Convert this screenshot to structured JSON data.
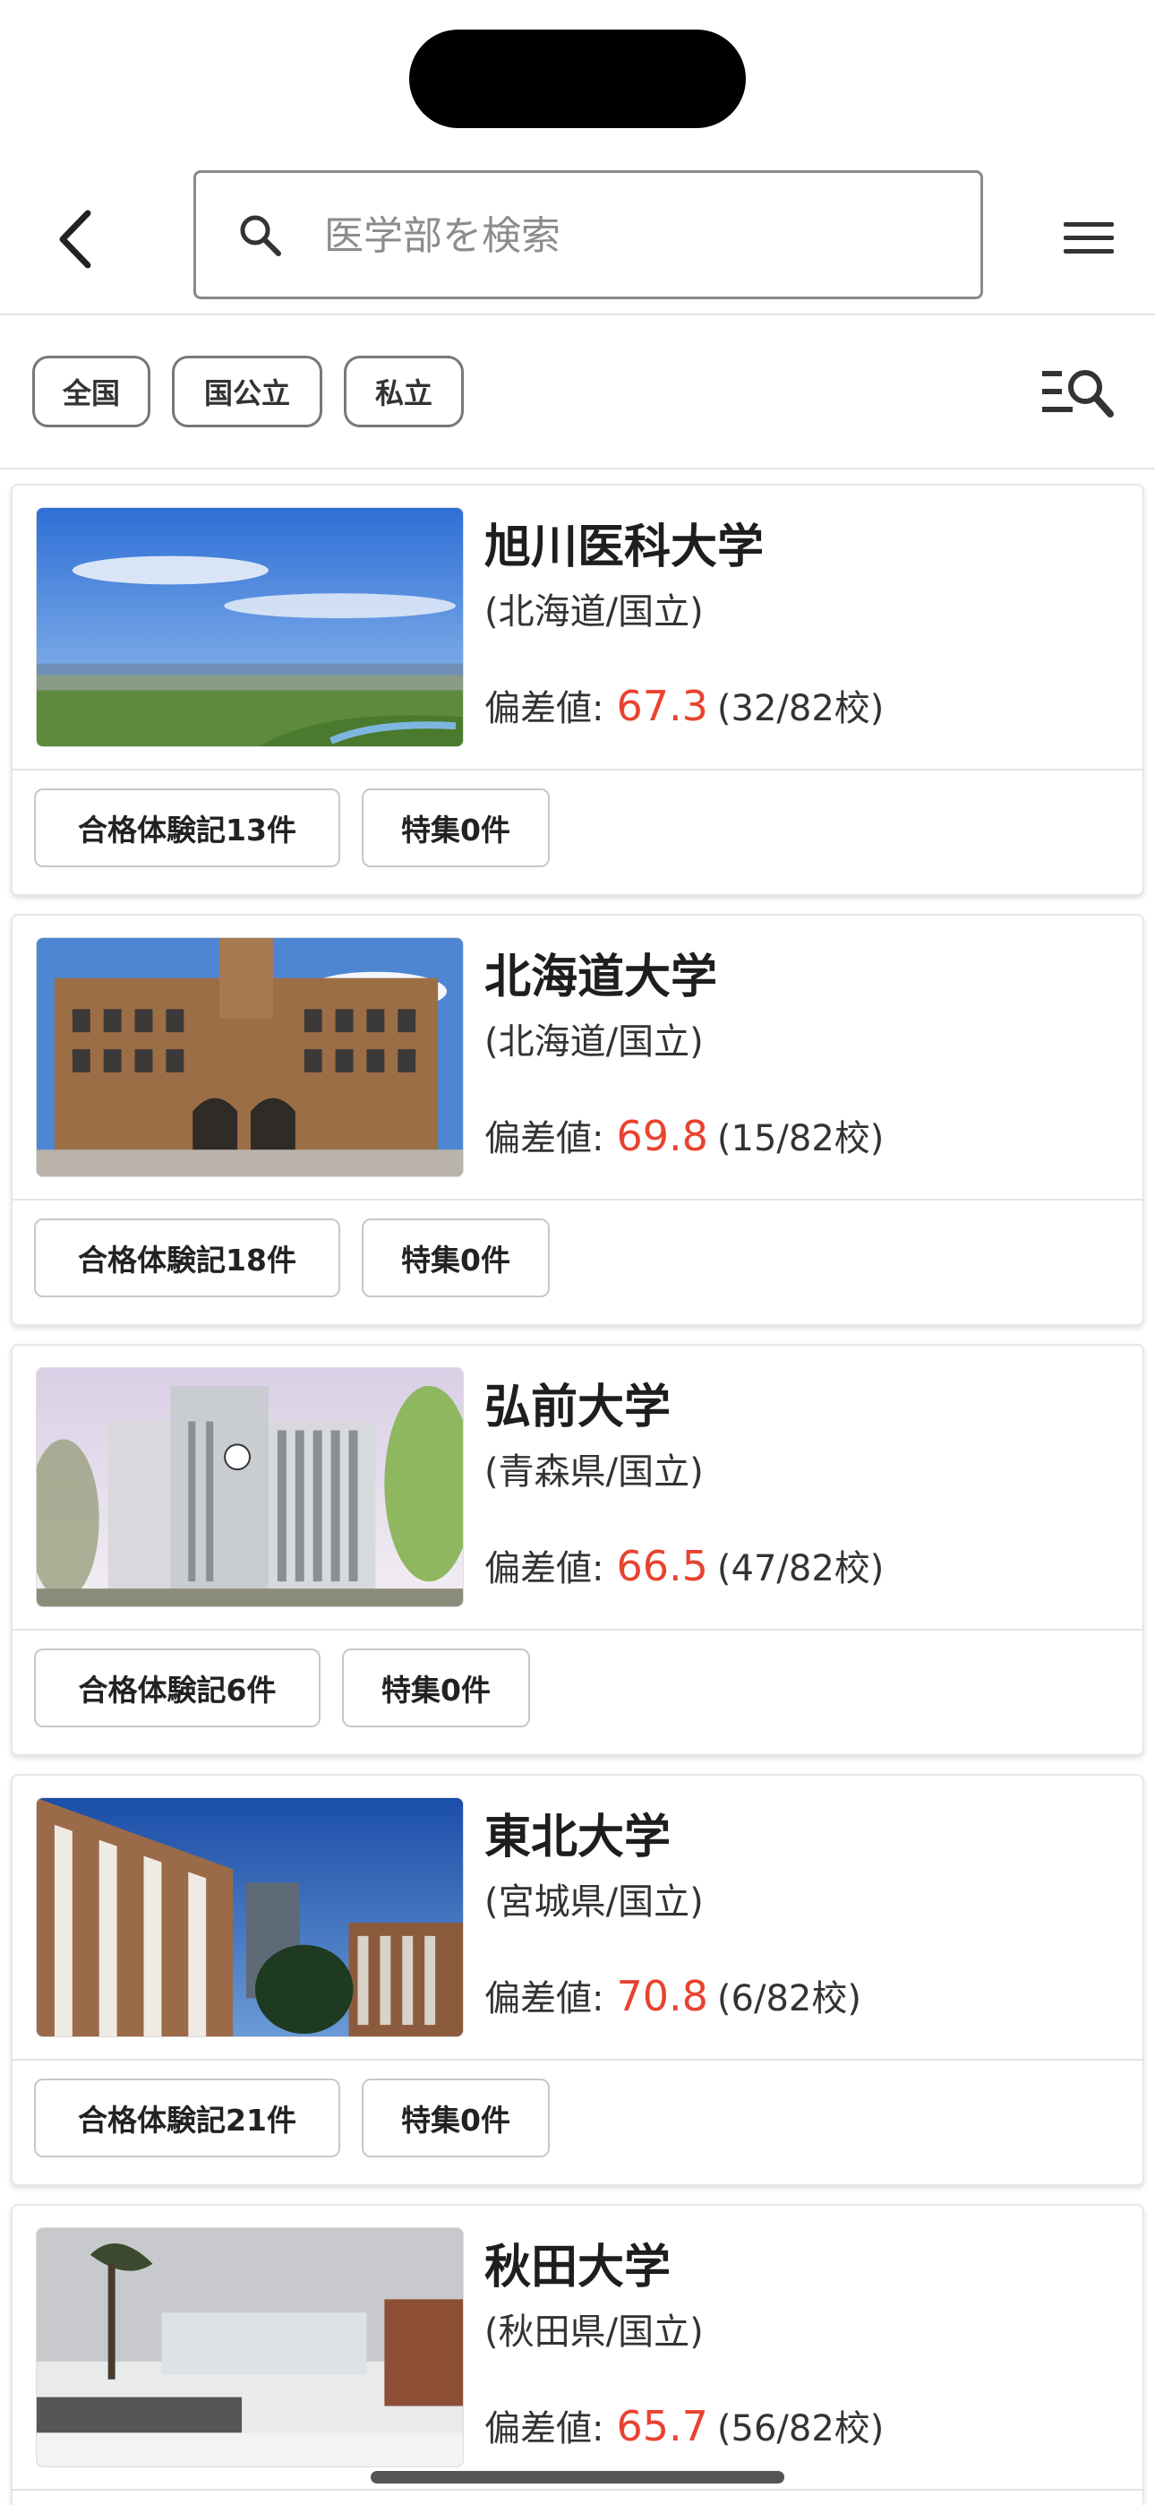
{
  "search": {
    "placeholder": "医学部を検索"
  },
  "filters": {
    "chips": [
      "全国",
      "国公立",
      "私立"
    ]
  },
  "labels": {
    "score_prefix": "偏差値:"
  },
  "colors": {
    "score": "#e8432f",
    "border": "#777777"
  },
  "icons": {
    "back": "chevron-left-icon",
    "search": "search-icon",
    "menu": "hamburger-icon",
    "filter": "filter-search-icon"
  },
  "universities": [
    {
      "name": "旭川医科大学",
      "location": "(北海道/国立)",
      "score": "67.3",
      "rank": "(32/82校)",
      "reports": "合格体験記13件",
      "features": "特集0件"
    },
    {
      "name": "北海道大学",
      "location": "(北海道/国立)",
      "score": "69.8",
      "rank": "(15/82校)",
      "reports": "合格体験記18件",
      "features": "特集0件"
    },
    {
      "name": "弘前大学",
      "location": "(青森県/国立)",
      "score": "66.5",
      "rank": "(47/82校)",
      "reports": "合格体験記6件",
      "features": "特集0件"
    },
    {
      "name": "東北大学",
      "location": "(宮城県/国立)",
      "score": "70.8",
      "rank": "(6/82校)",
      "reports": "合格体験記21件",
      "features": "特集0件"
    },
    {
      "name": "秋田大学",
      "location": "(秋田県/国立)",
      "score": "65.7",
      "rank": "(56/82校)"
    }
  ]
}
